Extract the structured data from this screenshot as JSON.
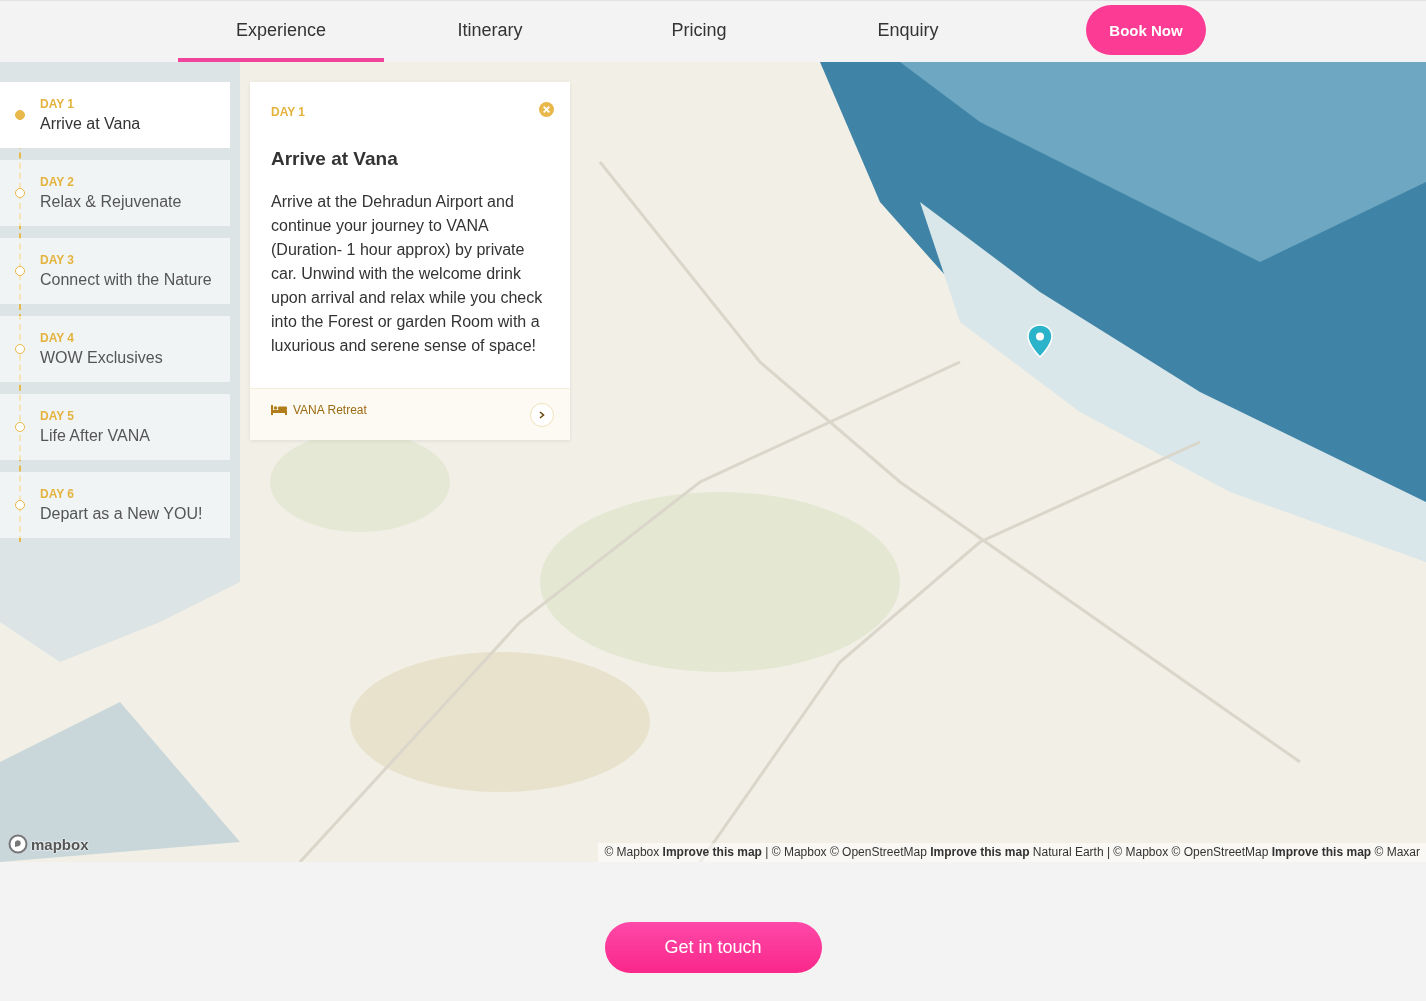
{
  "nav": {
    "tabs": [
      {
        "label": "Experience",
        "selected": true
      },
      {
        "label": "Itinerary",
        "selected": false
      },
      {
        "label": "Pricing",
        "selected": false
      },
      {
        "label": "Enquiry",
        "selected": false
      }
    ],
    "cta": "Book Now"
  },
  "itinerary": {
    "days": [
      {
        "day": "DAY 1",
        "title": "Arrive at Vana",
        "selected": true
      },
      {
        "day": "DAY 2",
        "title": "Relax & Rejuvenate",
        "selected": false
      },
      {
        "day": "DAY 3",
        "title": "Connect with the Nature",
        "selected": false
      },
      {
        "day": "DAY 4",
        "title": "WOW Exclusives",
        "selected": false
      },
      {
        "day": "DAY 5",
        "title": "Life After VANA",
        "selected": false
      },
      {
        "day": "DAY 6",
        "title": "Depart as a New YOU!",
        "selected": false
      }
    ]
  },
  "detail": {
    "day": "DAY 1",
    "title": "Arrive at Vana",
    "body": "Arrive at the Dehradun Airport and continue your journey to VANA (Duration- 1 hour approx) by private car. Unwind with the welcome drink upon arrival and relax while you check into the Forest or garden Room with a luxurious and serene sense of space!",
    "stay": "VANA Retreat"
  },
  "map": {
    "kind": "picture",
    "logo": "mapbox",
    "attribution": [
      {
        "kind": "plain",
        "text": "© Mapbox "
      },
      {
        "kind": "link",
        "text": "Improve this map"
      },
      {
        "kind": "plain",
        "text": " | © Mapbox © OpenStreetMap "
      },
      {
        "kind": "link",
        "text": "Improve this map"
      },
      {
        "kind": "plain",
        "text": " Natural Earth | © Mapbox © OpenStreetMap "
      },
      {
        "kind": "link",
        "text": "Improve this map"
      },
      {
        "kind": "plain",
        "text": " © Maxar"
      }
    ]
  },
  "footer": {
    "cta": "Get in touch"
  }
}
